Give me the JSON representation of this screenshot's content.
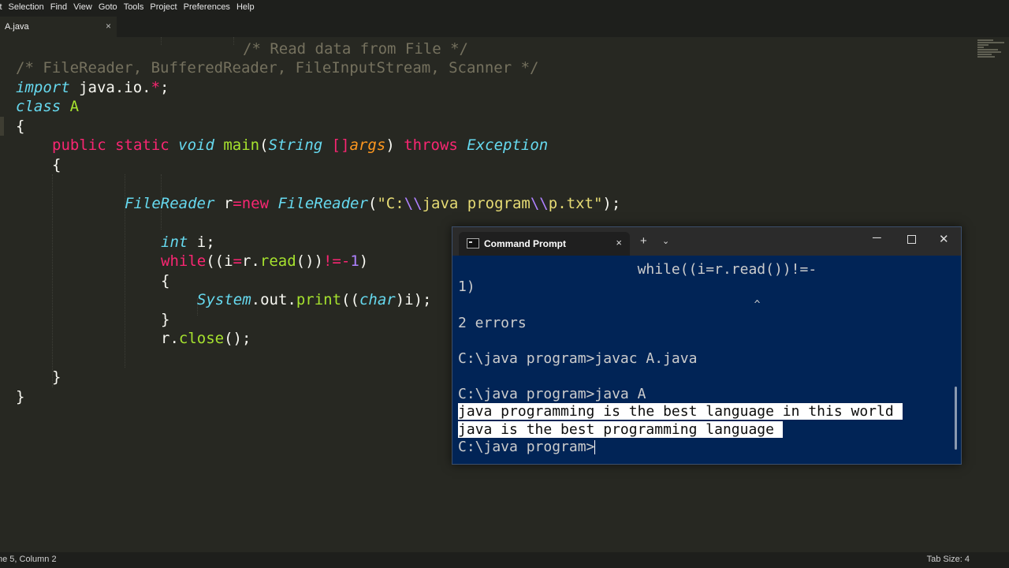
{
  "menu": [
    "it",
    "Selection",
    "Find",
    "View",
    "Goto",
    "Tools",
    "Project",
    "Preferences",
    "Help"
  ],
  "tab": {
    "name": "A.java",
    "close": "×"
  },
  "code": {
    "l1_comment": "/* Read data from File */",
    "l2_comment": "/* FileReader, BufferedReader, FileInputStream, Scanner */",
    "l3_import": "import",
    "l3_pkg": " java.io.",
    "l3_star": "*",
    "l3_semi": ";",
    "l4_class": "class",
    "l4_name": " A",
    "l5_brace": "{",
    "l6_public": "public",
    "l6_static": " static ",
    "l6_void": "void",
    "l6_main": " main",
    "l6_paren_open": "(",
    "l6_string": "String",
    "l6_brackets": " []",
    "l6_args": "args",
    "l6_paren_close": ") ",
    "l6_throws": "throws",
    "l6_exception": " Exception",
    "l7_brace": "{",
    "l8_type": "FileReader",
    "l8_var": " r",
    "l8_eq": "=",
    "l8_new": "new",
    "l8_ctor": " FileReader",
    "l8_open": "(",
    "l8_str1": "\"C:",
    "l8_esc1": "\\\\",
    "l8_str2": "java program",
    "l8_esc2": "\\\\",
    "l8_str3": "p.txt\"",
    "l8_close": ");",
    "l9_int": "int",
    "l9_rest": " i;",
    "l10_while": "while",
    "l10_a": "((i",
    "l10_eq": "=",
    "l10_b": "r.",
    "l10_read": "read",
    "l10_c": "())",
    "l10_ne": "!=",
    "l10_minus": "-",
    "l10_one": "1",
    "l10_d": ")",
    "l11_brace": "{",
    "l12_system": "System",
    "l12_a": ".out.",
    "l12_print": "print",
    "l12_b": "((",
    "l12_char": "char",
    "l12_c": ")i);",
    "l13_brace": "}",
    "l14_a": "r.",
    "l14_close": "close",
    "l14_b": "();",
    "l15_brace": "}",
    "l16_brace": "}"
  },
  "status": {
    "left": "ne 5, Column 2",
    "right": "Tab Size: 4"
  },
  "cmd": {
    "title": "Command Prompt",
    "close_tab": "×",
    "new_tab": "+",
    "dropdown": "⌄",
    "min": "─",
    "close": "✕",
    "lines": [
      "                     while((i=r.read())!=-",
      "1)",
      "                                                ^",
      "2 errors",
      "C:\\java program>javac A.java",
      "C:\\java program>java A"
    ],
    "output1": "java programming is the best language in this world ",
    "output2": "java is the best programming language ",
    "prompt": "C:\\java program>"
  }
}
